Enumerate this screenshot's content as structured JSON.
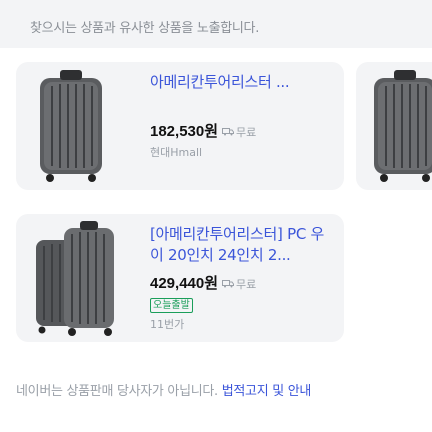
{
  "notice": {
    "text": "찾으시는 상품과 유사한 상품을 노출합니다."
  },
  "products": [
    {
      "title": "아메리칸투어리스터 ... ",
      "price": "182,530원",
      "shipping": "무료",
      "mall": "현대Hmall",
      "badge": "",
      "count": ""
    },
    {
      "title": "[아메리칸투어리스터] PC 우이 20인치 24인치 2...",
      "price": "429,440원",
      "shipping": "무료",
      "mall": "",
      "badge": "오늘출발",
      "count": "11번가"
    }
  ],
  "footer": {
    "text": "네이버는 상품판매 당사자가 아닙니다.",
    "link_label": "법적고지 및 안내"
  },
  "colors": {
    "title": "#3b55d9",
    "badge": "#1a9e5a",
    "card_bg": "#f3f4f6"
  }
}
